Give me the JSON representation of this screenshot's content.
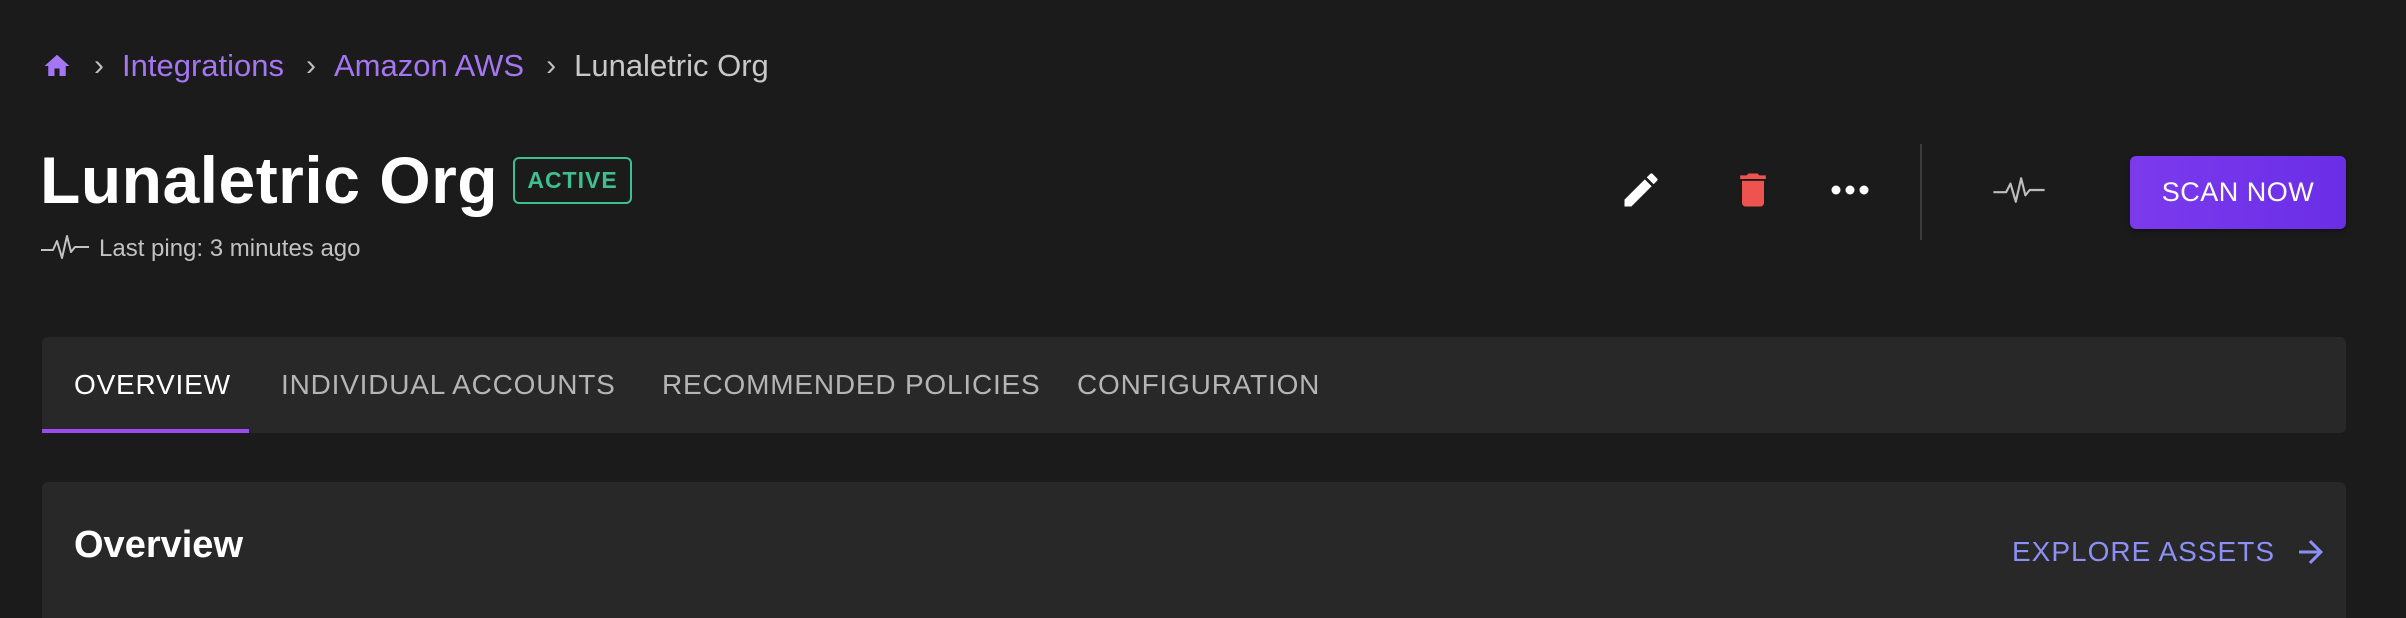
{
  "breadcrumb": {
    "home_icon": "home-icon",
    "items": [
      {
        "label": "Integrations",
        "link": true
      },
      {
        "label": "Amazon AWS",
        "link": true
      },
      {
        "label": "Lunaletric Org",
        "link": false
      }
    ],
    "separator": "›"
  },
  "header": {
    "title": "Lunaletric Org",
    "status": "ACTIVE",
    "last_ping": "Last ping: 3 minutes ago"
  },
  "actions": {
    "edit_icon": "pencil-icon",
    "delete_icon": "trash-icon",
    "more_icon": "more-horizontal-icon",
    "heartbeat_icon": "heartbeat-icon",
    "scan_label": "SCAN NOW"
  },
  "tabs": [
    {
      "label": "OVERVIEW",
      "active": true
    },
    {
      "label": "INDIVIDUAL ACCOUNTS",
      "active": false
    },
    {
      "label": "RECOMMENDED POLICIES",
      "active": false
    },
    {
      "label": "CONFIGURATION",
      "active": false
    }
  ],
  "overview": {
    "title": "Overview",
    "explore_label": "EXPLORE ASSETS"
  },
  "colors": {
    "background": "#1c1b1b",
    "accent": "#7c3aed",
    "link": "#a476f2",
    "active_badge": "#3fbf8f",
    "delete": "#ef5350",
    "explore": "#8c8ff5"
  }
}
